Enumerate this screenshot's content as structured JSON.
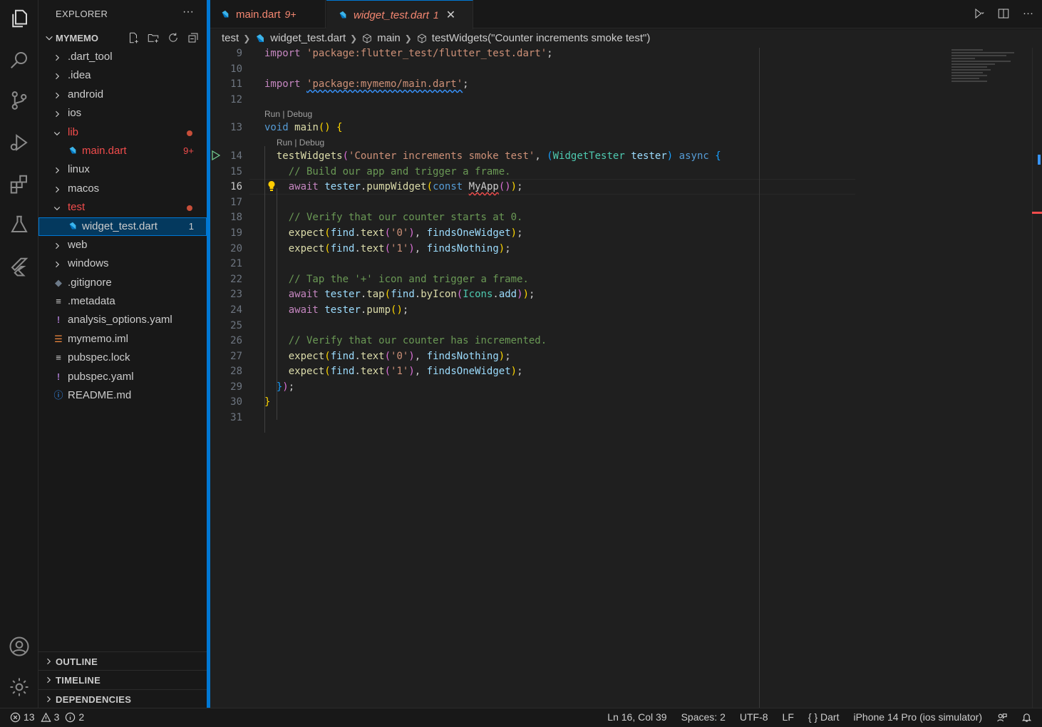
{
  "sidebar": {
    "title": "EXPLORER",
    "more": "···",
    "root": "MYMEMO",
    "items": [
      {
        "label": ".dart_tool",
        "type": "folder",
        "open": false,
        "depth": 0
      },
      {
        "label": ".idea",
        "type": "folder",
        "open": false,
        "depth": 0
      },
      {
        "label": "android",
        "type": "folder",
        "open": false,
        "depth": 0
      },
      {
        "label": "ios",
        "type": "folder",
        "open": false,
        "depth": 0
      },
      {
        "label": "lib",
        "type": "folder",
        "open": true,
        "depth": 0,
        "error": true
      },
      {
        "label": "main.dart",
        "type": "dart",
        "depth": 1,
        "error": true,
        "badge": "9+"
      },
      {
        "label": "linux",
        "type": "folder",
        "open": false,
        "depth": 0
      },
      {
        "label": "macos",
        "type": "folder",
        "open": false,
        "depth": 0
      },
      {
        "label": "test",
        "type": "folder",
        "open": true,
        "depth": 0,
        "error": true
      },
      {
        "label": "widget_test.dart",
        "type": "dart",
        "depth": 1,
        "selected": true,
        "badge": "1"
      },
      {
        "label": "web",
        "type": "folder",
        "open": false,
        "depth": 0
      },
      {
        "label": "windows",
        "type": "folder",
        "open": false,
        "depth": 0
      },
      {
        "label": ".gitignore",
        "type": "git",
        "depth": 0
      },
      {
        "label": ".metadata",
        "type": "lines",
        "depth": 0
      },
      {
        "label": "analysis_options.yaml",
        "type": "yaml",
        "depth": 0
      },
      {
        "label": "mymemo.iml",
        "type": "rss",
        "depth": 0
      },
      {
        "label": "pubspec.lock",
        "type": "lines",
        "depth": 0
      },
      {
        "label": "pubspec.yaml",
        "type": "yaml",
        "depth": 0
      },
      {
        "label": "README.md",
        "type": "info",
        "depth": 0
      }
    ],
    "sections": [
      "OUTLINE",
      "TIMELINE",
      "DEPENDENCIES"
    ]
  },
  "tabs": [
    {
      "label": "main.dart",
      "count": "9+"
    },
    {
      "label": "widget_test.dart",
      "count": "1",
      "active": true
    }
  ],
  "breadcrumb": [
    "test",
    "widget_test.dart",
    "main",
    "testWidgets(\"Counter increments smoke test\")"
  ],
  "codelens": "Run | Debug",
  "code_lines": [
    {
      "n": "9"
    },
    {
      "n": "10"
    },
    {
      "n": "11"
    },
    {
      "n": "12"
    },
    {
      "n": "13"
    },
    {
      "n": "14"
    },
    {
      "n": "15"
    },
    {
      "n": "16"
    },
    {
      "n": "17"
    },
    {
      "n": "18"
    },
    {
      "n": "19"
    },
    {
      "n": "20"
    },
    {
      "n": "21"
    },
    {
      "n": "22"
    },
    {
      "n": "23"
    },
    {
      "n": "24"
    },
    {
      "n": "25"
    },
    {
      "n": "26"
    },
    {
      "n": "27"
    },
    {
      "n": "28"
    },
    {
      "n": "29"
    },
    {
      "n": "30"
    },
    {
      "n": "31"
    }
  ],
  "code": {
    "l9_import": "import",
    "l9_str": "'package:flutter_test/flutter_test.dart'",
    "l11_import": "import",
    "l11_str": "'package:mymemo/main.dart'",
    "l13_void": "void",
    "l13_main": "main",
    "l14_fn": "testWidgets",
    "l14_str": "'Counter increments smoke test'",
    "l14_type": "WidgetTester",
    "l14_param": "tester",
    "l14_async": "async",
    "l15_comment": "// Build our app and trigger a frame.",
    "l16_await": "await",
    "l16_obj": "tester",
    "l16_method": "pumpWidget",
    "l16_const": "const",
    "l16_cls": "MyApp",
    "l18_comment": "// Verify that our counter starts at 0.",
    "l22_comment": "// Tap the '+' icon and trigger a frame.",
    "l26_comment": "// Verify that our counter has incremented.",
    "expect": "expect",
    "find": "find",
    "text": "text",
    "s0": "'0'",
    "s1": "'1'",
    "findsOne": "findsOneWidget",
    "findsNothing": "findsNothing",
    "tap": "tap",
    "byIcon": "byIcon",
    "Icons": "Icons",
    "add": "add",
    "pump": "pump"
  },
  "status": {
    "errors": "13",
    "warnings": "3",
    "infos": "2",
    "position": "Ln 16, Col 39",
    "spaces": "Spaces: 2",
    "encoding": "UTF-8",
    "eol": "LF",
    "language": "Dart",
    "device": "iPhone 14 Pro (ios simulator)"
  },
  "colors": {
    "accent": "#0078d4",
    "error": "#f14c4c",
    "tab_error": "#f48771"
  }
}
